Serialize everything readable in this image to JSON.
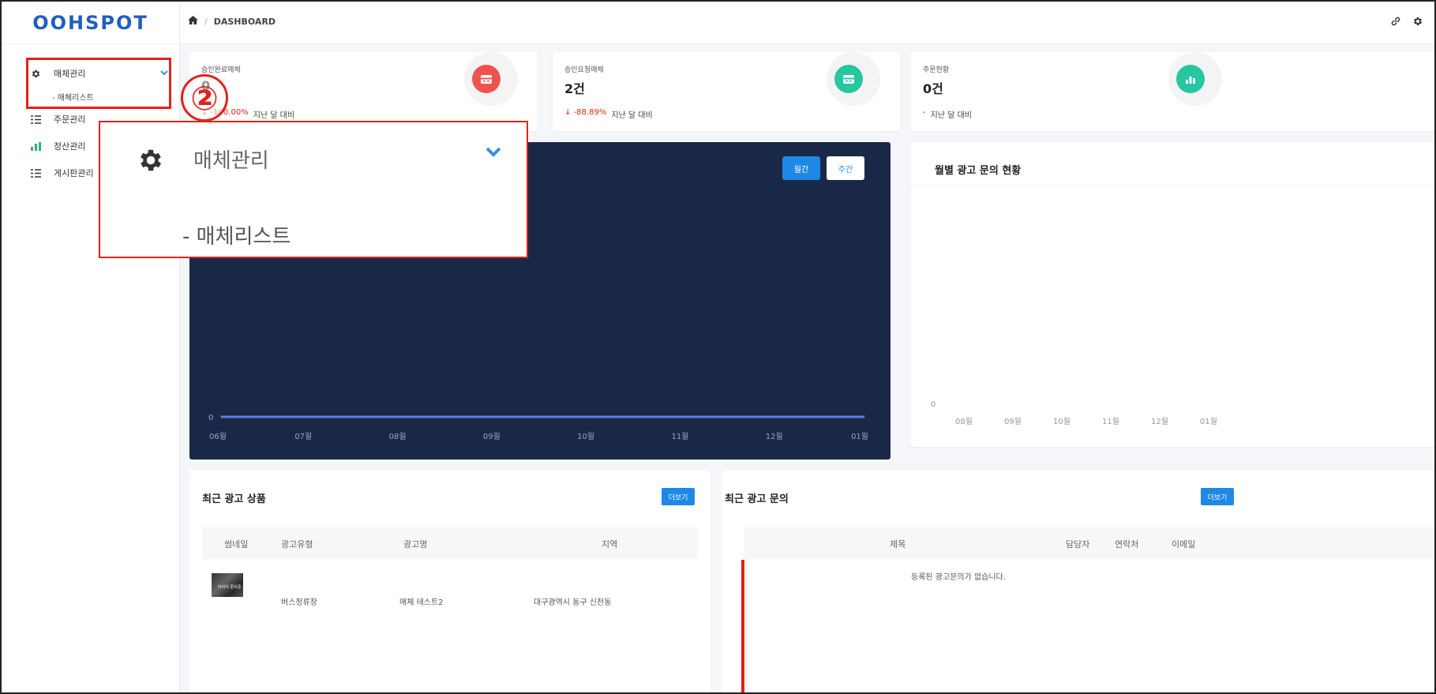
{
  "app": {
    "logo": "OOHSPOT"
  },
  "sidebar": {
    "items": [
      {
        "label": "매체관리",
        "icon": "gear-icon",
        "sub": "- 매체리스트"
      },
      {
        "label": "주문관리",
        "icon": "list-icon"
      },
      {
        "label": "정산관리",
        "icon": "bar-chart-icon"
      },
      {
        "label": "게시판관리",
        "icon": "list-icon"
      }
    ]
  },
  "annotation": {
    "number": "②"
  },
  "zoom": {
    "title": "매체관리",
    "sub": "- 매체리스트"
  },
  "breadcrumb": {
    "page": "DASHBOARD"
  },
  "stats": [
    {
      "title": "승인완료매체",
      "value": "0",
      "change": "-100.00%",
      "suffix": "지난 달 대비",
      "color": "#ef5350"
    },
    {
      "title": "승인요청매체",
      "value": "2건",
      "change": "-88.89%",
      "suffix": "지난 달 대비",
      "color": "#26c6a0"
    },
    {
      "title": "주문현황",
      "value": "0건",
      "change": "-",
      "suffix": "지난 달 대비",
      "color": "#26c6a0"
    }
  ],
  "main_chart": {
    "toggle_monthly": "월간",
    "toggle_weekly": "주간"
  },
  "chart_data": [
    {
      "type": "area",
      "categories": [
        "06월",
        "07월",
        "08월",
        "09월",
        "10월",
        "11월",
        "12월",
        "01월"
      ],
      "series": [
        {
          "values": [
            0,
            0,
            0,
            0,
            0,
            0,
            0,
            0
          ]
        }
      ],
      "y_tick": "0"
    },
    {
      "type": "bar",
      "title": "월별 광고 문의 현황",
      "categories": [
        "08월",
        "09월",
        "10월",
        "11월",
        "12월",
        "01월"
      ],
      "series": [
        {
          "values": [
            0,
            0,
            0,
            0,
            0,
            0
          ]
        }
      ],
      "y_tick": "0"
    }
  ],
  "recent_products": {
    "title": "최근 광고 상품",
    "more": "더보기",
    "columns": [
      "썸네일",
      "광고유형",
      "광고명",
      "지역"
    ],
    "rows": [
      {
        "thumb": "이미지 준비중",
        "type": "버스정류장",
        "name": "매체 테스트2",
        "region": "대구광역시 동구 신천동"
      }
    ]
  },
  "recent_inquiries": {
    "title": "최근 광고 문의",
    "more": "더보기",
    "columns": [
      "제목",
      "담당자",
      "연락처",
      "이메일"
    ],
    "empty": "등록된 광고문의가 없습니다."
  }
}
